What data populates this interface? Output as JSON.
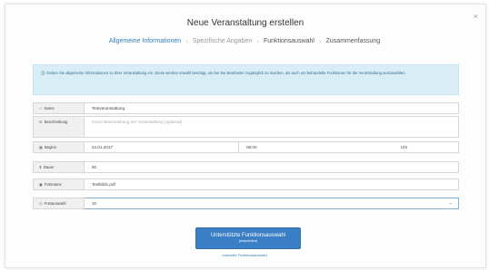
{
  "modal": {
    "title": "Neue Veranstaltung erstellen",
    "close_label": "×"
  },
  "steps": [
    {
      "label": "Allgemeine Informationen",
      "active": true
    },
    {
      "label": "Spezifische Angaben",
      "active": false
    },
    {
      "label": "Funktionsauswahl",
      "active": false
    },
    {
      "label": "Zusammenfassung",
      "active": false
    }
  ],
  "info": {
    "icon": "info-icon",
    "text": "Geben Sie allgemeine Informationen zu Ihrer Veranstaltung ein. Diese werden sowohl benötigt, um bei Sie Bearbeiter zugänglich zu machen, als auch um behandelte Funktionen für die Veranstaltung auszuwählen."
  },
  "form": {
    "name": {
      "icon": "check-icon",
      "label": "Name",
      "value": "Testveranstaltung"
    },
    "beschreibung": {
      "icon": "list-icon",
      "label": "Beschreibung",
      "placeholder": "Kurze Beschreibung der Veranstaltung (optional)"
    },
    "beginn": {
      "icon": "calendar-icon",
      "label": "Beginn",
      "date": "24.01.2017",
      "time": "08:00",
      "unit": "Uhr"
    },
    "dauer": {
      "icon": "hourglass-icon",
      "label": "Dauer",
      "value": "60"
    },
    "fotoname": {
      "icon": "image-icon",
      "label": "Fotoname",
      "value": "Testbild1.pdf"
    },
    "fotoauswahl": {
      "icon": "clock-icon",
      "label": "Fotoauswahl",
      "value": "10"
    }
  },
  "actions": {
    "primary_label": "Unterstützte Funktionsauswahl",
    "primary_sub": "(empfohlen)",
    "secondary_label": "manuelle Funktionsauswahl"
  }
}
